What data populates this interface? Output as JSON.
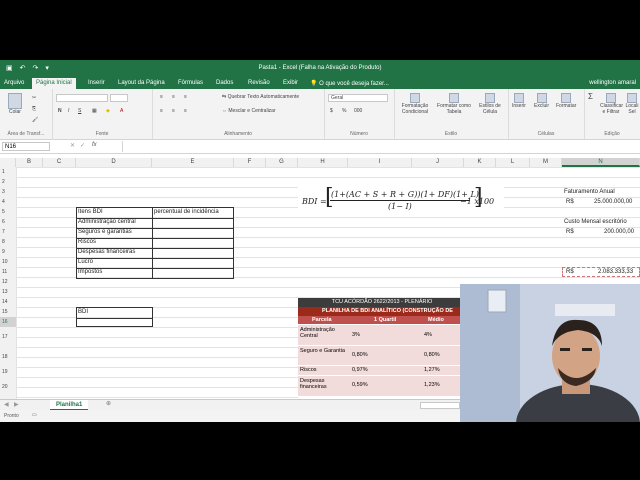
{
  "window": {
    "title": "Pasta1 - Excel (Falha na Ativação do Produto)"
  },
  "tabs": [
    "Arquivo",
    "Página Inicial",
    "Inserir",
    "Layout da Página",
    "Fórmulas",
    "Dados",
    "Revisão",
    "Exibir"
  ],
  "active_tab": "Página Inicial",
  "tell_me": "O que você deseja fazer...",
  "user": "wellington amaral",
  "ribbon": {
    "clipboard": {
      "paste": "Colar",
      "label": "Área de Transf..."
    },
    "font": {
      "bold": "N",
      "italic": "I",
      "underline": "S",
      "label": "Fonte"
    },
    "alignment": {
      "wrap": "Quebrar Texto Automaticamente",
      "merge": "Mesclar e Centralizar",
      "label": "Alinhamento"
    },
    "number": {
      "format": "Geral",
      "label": "Número"
    },
    "styles": {
      "cond": "Formatação Condicional",
      "table": "Formatar como Tabela",
      "cell": "Estilos de Célula",
      "label": "Estilo"
    },
    "cells": {
      "insert": "Inserir",
      "delete": "Excluir",
      "format": "Formatar",
      "label": "Células"
    },
    "editing": {
      "sum": "Σ",
      "sort": "Classificar e Filtrar",
      "find": "Locali Sel",
      "label": "Edição"
    }
  },
  "formula_bar": {
    "name_box": "N16",
    "fx": "fx",
    "value": ""
  },
  "columns": [
    "B",
    "C",
    "D",
    "E",
    "F",
    "G",
    "H",
    "I",
    "J",
    "K",
    "L",
    "M",
    "N"
  ],
  "selected_column": "N",
  "rows": [
    "1",
    "2",
    "3",
    "4",
    "5",
    "6",
    "7",
    "8",
    "9",
    "10",
    "11",
    "12",
    "13",
    "14",
    "15",
    "16",
    "17",
    "18",
    "19",
    "20"
  ],
  "selected_row": "16",
  "cells": {
    "d5": "Itens BDI",
    "e5": "percentual de incidência",
    "d6": "Administração central",
    "d7": "Seguros e garantias",
    "d8": "Riscos",
    "d9": "Despesas financeiras",
    "d10": "Lucro",
    "d11": "Impostos",
    "d15": "BDI",
    "n3": "Faturamento Anual",
    "n4_cur": "R$",
    "n4_val": "25.000.000,00",
    "n6": "Custo Mensal escritório",
    "n7_cur": "R$",
    "n7_val": "200.000,00",
    "n11_cur": "R$",
    "n11_val": "2.083.333,33"
  },
  "formula_image": {
    "lhs": "BDI =",
    "numerator": "(1+(AC + S + R + G))(1+ DF)(1+ L)",
    "denominator": "(1− I)",
    "tail": "−1 x100"
  },
  "tcu_table": {
    "title": "TCU ACÓRDÃO 2622/2013 - PLENÁRIO",
    "subtitle": "PLANILHA DE BDI ANALÍTICO (CONSTRUÇÃO DE EDIF",
    "headers": [
      "Parcela",
      "1 Quartil",
      "Médio"
    ],
    "rows": [
      {
        "name": "Administração Central",
        "q1": "3%",
        "med": "4%"
      },
      {
        "name": "Seguro e Garantia",
        "q1": "0,80%",
        "med": "0,80%"
      },
      {
        "name": "Riscos",
        "q1": "0,97%",
        "med": "1,27%"
      },
      {
        "name": "Despesas financeiras",
        "q1": "0,59%",
        "med": "1,23%"
      }
    ]
  },
  "sheet_tab": "Planilha1",
  "status": "Pronto"
}
